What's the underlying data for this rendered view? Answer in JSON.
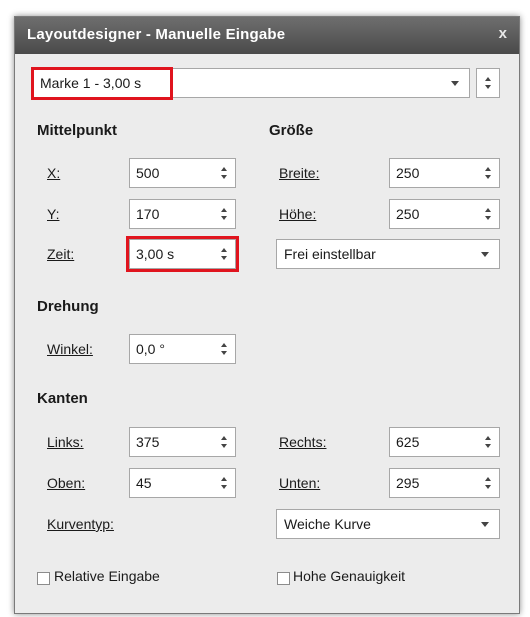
{
  "window": {
    "title": "Layoutdesigner - Manuelle Eingabe",
    "close_label": "x"
  },
  "marker_select": {
    "value": "Marke 1 - 3,00 s"
  },
  "mittelpunkt": {
    "heading": "Mittelpunkt",
    "x_label": "X:",
    "x_value": "500",
    "y_label": "Y:",
    "y_value": "170",
    "zeit_label": "Zeit:",
    "zeit_value": "3,00 s"
  },
  "groesse": {
    "heading": "Größe",
    "breite_label": "Breite:",
    "breite_value": "250",
    "hoehe_label": "Höhe:",
    "hoehe_value": "250",
    "mode_value": "Frei einstellbar"
  },
  "drehung": {
    "heading": "Drehung",
    "winkel_label": "Winkel:",
    "winkel_value": "0,0 °"
  },
  "kanten": {
    "heading": "Kanten",
    "links_label": "Links:",
    "links_value": "375",
    "rechts_label": "Rechts:",
    "rechts_value": "625",
    "oben_label": "Oben:",
    "oben_value": "45",
    "unten_label": "Unten:",
    "unten_value": "295",
    "kurventyp_label": "Kurventyp:",
    "kurventyp_value": "Weiche Kurve"
  },
  "options": {
    "relative_label": "Relative Eingabe",
    "relative_checked": false,
    "genauigkeit_label": "Hohe Genauigkeit",
    "genauigkeit_checked": false
  },
  "highlight_color": "#e0141e"
}
